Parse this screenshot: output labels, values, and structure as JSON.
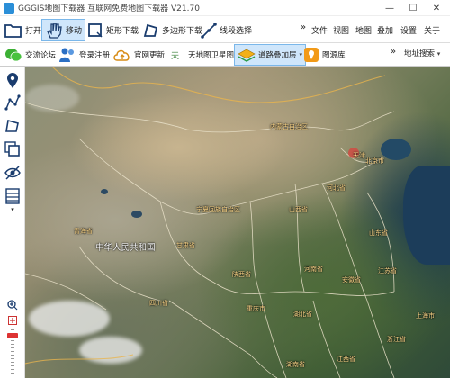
{
  "window": {
    "title": "GGGIS地图下载器  互联网免费地图下载器 V21.70",
    "controls": [
      "—",
      "☐",
      "✕"
    ]
  },
  "toolbar1": {
    "open_label": "打开",
    "move_label": "移动",
    "rect_download_label": "矩形下载",
    "polygon_download_label": "多边形下载",
    "polyline_select_label": "线段选择",
    "overflow": "»",
    "menus": [
      "文件",
      "视图",
      "地图",
      "叠加",
      "设置",
      "关于"
    ]
  },
  "toolbar2": {
    "forum_label": "交流论坛",
    "register_label": "登录注册",
    "update_label": "官网更新",
    "tianditu_label": "天地图卫星图",
    "road_overlay_label": "道路叠加层",
    "map_library_label": "图源库",
    "overflow": "»",
    "address_search_label": "地址搜索"
  },
  "map": {
    "country_label": "中华人民共和国",
    "provinces": [
      "内蒙古自治区",
      "北京市",
      "天津",
      "河北省",
      "山西省",
      "宁夏回族自治区",
      "青海省",
      "甘肃省",
      "陕西省",
      "河南省",
      "山东省",
      "江苏省",
      "安徽省",
      "四川省",
      "湖北省",
      "重庆市",
      "上海市",
      "浙江省",
      "湖南省",
      "江西省"
    ]
  },
  "colors": {
    "accent": "#2b8fd8",
    "active_bg": "#cfe6fb",
    "label": "#ffd98a",
    "border": "#e8e0c8"
  }
}
